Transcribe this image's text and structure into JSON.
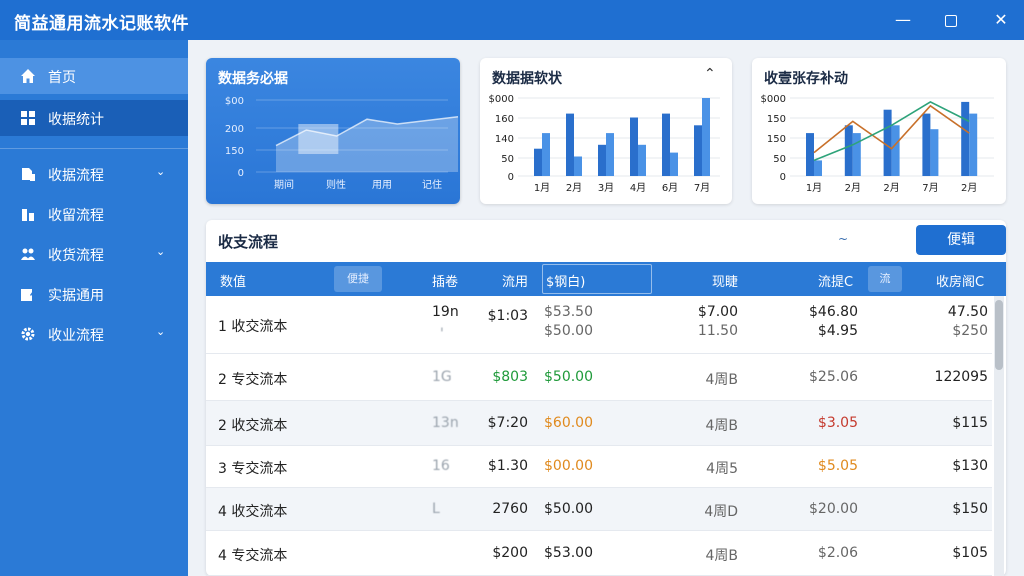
{
  "app": {
    "title": "简益通用流水记账软件"
  },
  "window": {
    "minimize": "—",
    "close": "✕"
  },
  "sidebar": {
    "items": [
      {
        "label": "首页",
        "icon": "home-icon",
        "chevron": ""
      },
      {
        "label": "收据统计",
        "icon": "grid-icon",
        "chevron": ""
      },
      {
        "label": "收据流程",
        "icon": "document-icon",
        "chevron": "⌄"
      },
      {
        "label": "收留流程",
        "icon": "bar-icon",
        "chevron": ""
      },
      {
        "label": "收货流程",
        "icon": "people-icon",
        "chevron": "⌄"
      },
      {
        "label": "实据通用",
        "icon": "edit-icon",
        "chevron": ""
      },
      {
        "label": "收业流程",
        "icon": "gear-icon",
        "chevron": "⌄"
      }
    ]
  },
  "cards": {
    "overview": {
      "title": "数据务必据"
    },
    "stats": {
      "title": "数据据软状",
      "caret": "⌃"
    },
    "trend": {
      "title": "收壹张存补动"
    }
  },
  "chart_data": [
    {
      "type": "area",
      "title": "数据务必据",
      "y_ticks": [
        "$00",
        "200",
        "150",
        "0"
      ],
      "categories": [
        "期间",
        "则性",
        "用用",
        "记住"
      ],
      "x": [
        0,
        0.5,
        1,
        1.5,
        2,
        2.5,
        3
      ],
      "values": [
        110,
        175,
        150,
        220,
        200,
        215,
        230
      ],
      "ylim": [
        0,
        300
      ]
    },
    {
      "type": "bar",
      "title": "数据据软状",
      "y_ticks": [
        "$000",
        "160",
        "140",
        "50",
        "0"
      ],
      "y_values": [
        200,
        160,
        140,
        50,
        0
      ],
      "categories": [
        "1月",
        "2月",
        "3月",
        "4月",
        "6月",
        "7月"
      ],
      "series": [
        {
          "values": [
            70,
            160,
            80,
            150,
            160,
            130
          ]
        },
        {
          "values": [
            110,
            50,
            110,
            80,
            60,
            200
          ]
        }
      ],
      "ylim": [
        0,
        200
      ]
    },
    {
      "type": "bar",
      "title": "收壹张存补动",
      "y_ticks": [
        "$000",
        "150",
        "150",
        "50",
        "0"
      ],
      "y_values": [
        200,
        150,
        150,
        50,
        0
      ],
      "categories": [
        "1月",
        "2月",
        "2月",
        "7月",
        "2月"
      ],
      "series": [
        {
          "values": [
            110,
            130,
            170,
            160,
            190
          ]
        },
        {
          "values": [
            40,
            110,
            130,
            120,
            160
          ]
        }
      ],
      "lines": [
        {
          "color": "#c8702a",
          "values": [
            60,
            140,
            70,
            180,
            110
          ]
        },
        {
          "color": "#2ea37a",
          "values": [
            40,
            80,
            130,
            190,
            140
          ]
        }
      ],
      "ylim": [
        0,
        200
      ]
    }
  ],
  "table": {
    "title": "收支流程",
    "wave": "~",
    "edit_label": "便辑",
    "headers": [
      "数值",
      "便捷",
      "插卷",
      "流用",
      "$钢白)",
      "现睫",
      "流提C",
      "流",
      "收房阁C"
    ],
    "rows": [
      {
        "name": "1 收交流本",
        "c1": "19n",
        "c1b": "'",
        "c2": "$1:03",
        "c3": "$53.50",
        "c3b": "$50.00",
        "c4": "$7.00",
        "c4b": "11.50",
        "c5": "$46.80",
        "c5b": "$4.95",
        "c6": "47.50",
        "c6b": "$250",
        "c2cls": "",
        "c3cls": "sub",
        "c5cls": ""
      },
      {
        "name": "2 专交流本",
        "c1": "1G",
        "c2": "$803",
        "c3": "$50.00",
        "c4": "4周B",
        "c5": "$25.06",
        "c6": "122095",
        "c2cls": "green",
        "c3cls": "green",
        "c5cls": ""
      },
      {
        "name": "2 收交流本",
        "c1": "13n",
        "c2": "$7:20",
        "c3": "$60.00",
        "c4": "4周B",
        "c5": "$3.05",
        "c6": "$115",
        "c2cls": "",
        "c3cls": "orange",
        "c5cls": "red"
      },
      {
        "name": "3 专交流本",
        "c1": "16",
        "c2": "$1.30",
        "c3": "$00.00",
        "c4": "4周5",
        "c5": "$5.05",
        "c6": "$130",
        "c2cls": "",
        "c3cls": "orange",
        "c5cls": "orange"
      },
      {
        "name": "4 收交流本",
        "c1": "L",
        "c2": "2760",
        "c3": "$50.00",
        "c4": "4周D",
        "c5": "$20.00",
        "c6": "$150",
        "c2cls": "",
        "c3cls": "",
        "c5cls": ""
      },
      {
        "name": "4 专交流本",
        "c1": "",
        "c2": "$200",
        "c3": "$53.00",
        "c4": "4周B",
        "c5": "$2.06",
        "c6": "$105",
        "c2cls": "",
        "c3cls": "",
        "c5cls": ""
      }
    ]
  }
}
